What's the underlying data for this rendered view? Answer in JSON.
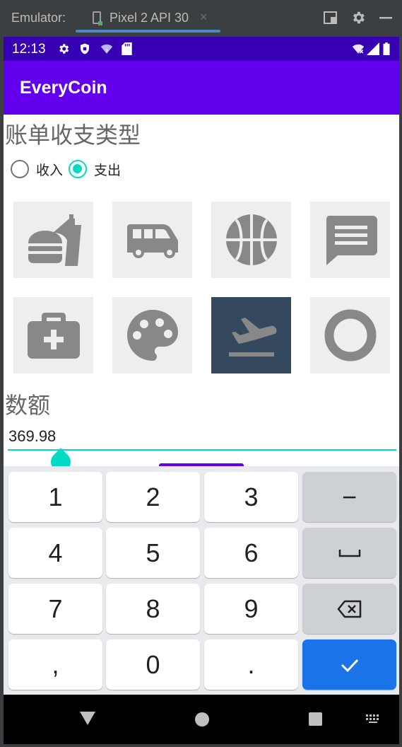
{
  "emulator": {
    "label": "Emulator:",
    "tab_title": "Pixel 2 API 30",
    "tab_close": "×"
  },
  "status_bar": {
    "time": "12:13",
    "icons": [
      "settings-icon",
      "shield-icon",
      "wifi-question-icon",
      "sd-card-icon",
      "wifi-off-icon",
      "signal-icon",
      "battery-icon"
    ]
  },
  "app_bar": {
    "title": "EveryCoin"
  },
  "bill_type": {
    "title": "账单收支类型",
    "options": [
      {
        "label": "收入",
        "selected": false
      },
      {
        "label": "支出",
        "selected": true
      }
    ]
  },
  "categories": [
    {
      "icon": "fastfood-icon",
      "selected": false
    },
    {
      "icon": "bus-icon",
      "selected": false
    },
    {
      "icon": "basketball-icon",
      "selected": false
    },
    {
      "icon": "message-icon",
      "selected": false
    },
    {
      "icon": "medical-kit-icon",
      "selected": false
    },
    {
      "icon": "palette-icon",
      "selected": true,
      "note": ""
    },
    {
      "icon": "flight-takeoff-icon",
      "selected": true
    },
    {
      "icon": "circle-icon",
      "selected": false
    }
  ],
  "amount": {
    "title": "数额",
    "value": "369.98"
  },
  "keyboard": {
    "rows": [
      [
        "1",
        "2",
        "3",
        "−"
      ],
      [
        "4",
        "5",
        "6",
        "␣"
      ],
      [
        "7",
        "8",
        "9",
        "⌫"
      ],
      [
        ",",
        "0",
        ".",
        "✓"
      ]
    ]
  },
  "colors": {
    "status_bar": "#3700b3",
    "app_bar": "#6200ee",
    "accent": "#03dac5",
    "selected_tile": "#34495e",
    "tile": "#eeeeee",
    "enter_key": "#1a73e8"
  }
}
